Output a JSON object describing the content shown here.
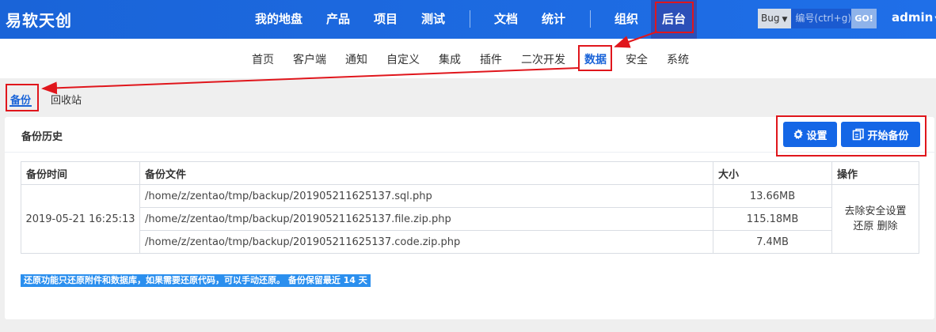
{
  "brand": "易软天创",
  "top_nav": [
    "我的地盘",
    "产品",
    "项目",
    "测试",
    "文档",
    "统计",
    "组织",
    "后台"
  ],
  "search": {
    "object": "Bug",
    "placeholder": "编号(ctrl+g)",
    "go": "GO!"
  },
  "user": "admin",
  "sub_nav": [
    "首页",
    "客户端",
    "通知",
    "自定义",
    "集成",
    "插件",
    "二次开发",
    "数据",
    "安全",
    "系统"
  ],
  "tabs": [
    "备份",
    "回收站"
  ],
  "panel": {
    "title": "备份历史",
    "settings_label": "设置",
    "start_backup_label": "开始备份"
  },
  "table": {
    "headers": [
      "备份时间",
      "备份文件",
      "大小",
      "操作"
    ],
    "time": "2019-05-21 16:25:13",
    "files": [
      {
        "path": "/home/z/zentao/tmp/backup/201905211625137.sql.php",
        "size": "13.66MB"
      },
      {
        "path": "/home/z/zentao/tmp/backup/201905211625137.file.zip.php",
        "size": "115.18MB"
      },
      {
        "path": "/home/z/zentao/tmp/backup/201905211625137.code.zip.php",
        "size": "7.4MB"
      }
    ],
    "ops": {
      "remove_security": "去除安全设置",
      "restore": "还原",
      "delete": "删除"
    }
  },
  "note": "还原功能只还原附件和数据库，如果需要还原代码，可以手动还原。 备份保留最近 14 天",
  "colors": {
    "primary": "#1466e6",
    "annotation": "#e0161c"
  }
}
